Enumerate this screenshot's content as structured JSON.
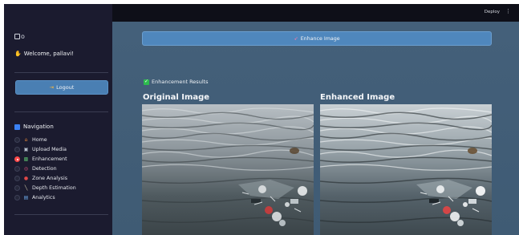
{
  "topbar": {
    "deploy_label": "Deploy",
    "menu_icon": "kebab-menu-icon"
  },
  "sidebar": {
    "logo_alt": "o",
    "welcome": "Welcome, pallavi!",
    "logout_label": "Logout",
    "navigation_title": "Navigation",
    "nav_items": [
      {
        "label": "Home",
        "icon": "home-icon",
        "selected": false
      },
      {
        "label": "Upload Media",
        "icon": "upload-icon",
        "selected": false
      },
      {
        "label": "Enhancement",
        "icon": "image-icon",
        "selected": true
      },
      {
        "label": "Detection",
        "icon": "target-icon",
        "selected": false
      },
      {
        "label": "Zone Analysis",
        "icon": "pin-icon",
        "selected": false
      },
      {
        "label": "Depth Estimation",
        "icon": "ruler-icon",
        "selected": false
      },
      {
        "label": "Analytics",
        "icon": "chart-icon",
        "selected": false
      }
    ]
  },
  "main": {
    "enhance_button_label": "Enhance Image",
    "results_heading": "Enhancement Results",
    "original_title": "Original Image",
    "enhanced_title": "Enhanced Image"
  },
  "colors": {
    "sidebar_bg": "#1b1b2f",
    "topbar_bg": "#0e0f18",
    "main_bg": "#44607a",
    "button_bg": "#4f87bd",
    "selected_radio": "#ff4b4b",
    "success": "#2dbb4e"
  }
}
